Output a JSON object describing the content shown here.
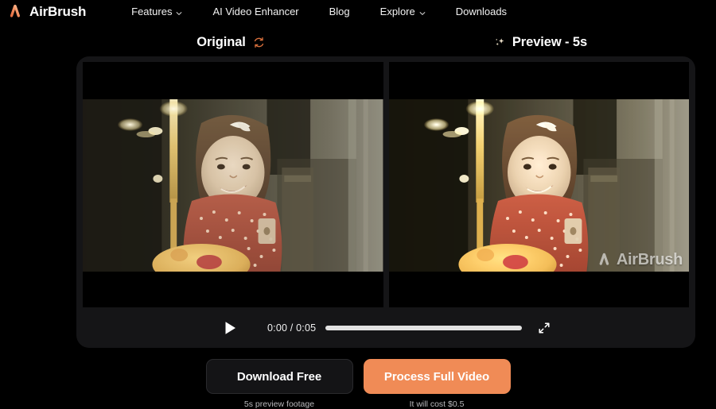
{
  "brand": {
    "name": "AirBrush",
    "logo_icon": "airbrush-a-logo",
    "accent": "#f08b56"
  },
  "nav": {
    "items": [
      {
        "label": "Features",
        "has_chevron": true,
        "icon": "chevron-down-icon"
      },
      {
        "label": "AI Video Enhancer",
        "has_chevron": false
      },
      {
        "label": "Blog",
        "has_chevron": false
      },
      {
        "label": "Explore",
        "has_chevron": true,
        "icon": "chevron-down-icon"
      },
      {
        "label": "Downloads",
        "has_chevron": false
      }
    ]
  },
  "comparison": {
    "left": {
      "title": "Original",
      "icon": "swap-refresh-icon"
    },
    "right": {
      "title": "Preview - 5s",
      "icon": "sparkles-icon",
      "sparkle_glyph": "✨",
      "watermark": "AirBrush"
    }
  },
  "player": {
    "play_icon": "play-icon",
    "current_time": "0:00",
    "separator": "/",
    "duration": "0:05",
    "time_display": "0:00 / 0:05",
    "progress_percent": 100,
    "expand_icon": "fullscreen-expand-icon"
  },
  "actions": {
    "download": {
      "label": "Download Free",
      "caption": "5s preview footage"
    },
    "process": {
      "label": "Process Full Video",
      "caption": "It will cost $0.5",
      "color": "#f08b56"
    }
  },
  "colors": {
    "page_background": "#000000",
    "card_background": "#151517",
    "accent": "#f08b56",
    "text_primary": "#ffffff",
    "text_muted": "#b9b9bc",
    "progress_fill": "#e2e2e2"
  }
}
